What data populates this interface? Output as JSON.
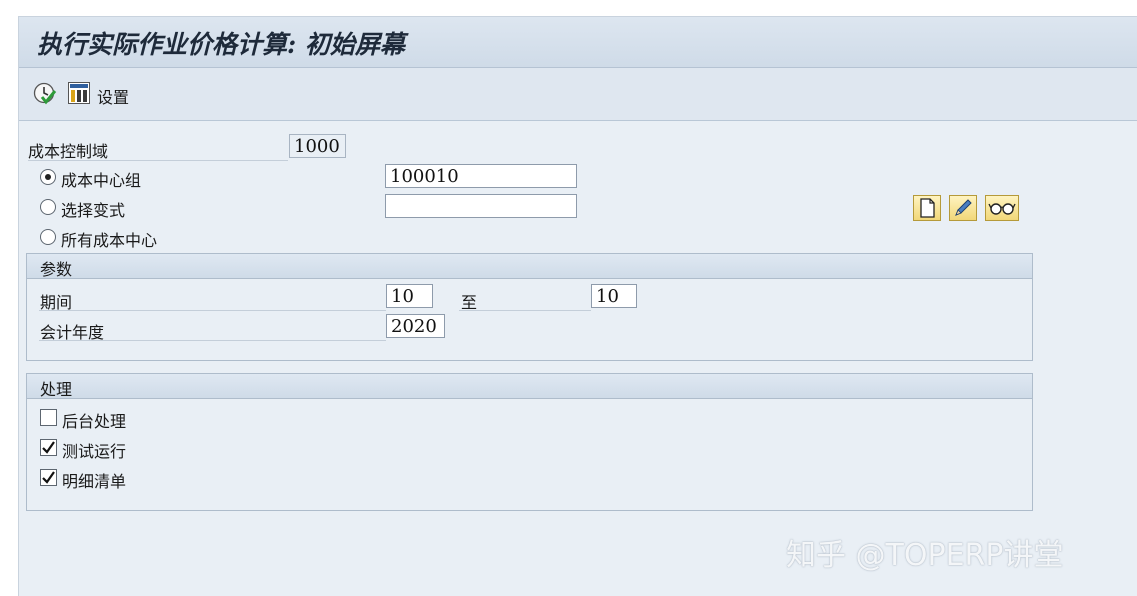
{
  "header": {
    "title": "执行实际作业价格计算: 初始屏幕"
  },
  "toolbar": {
    "settings_label": "设置"
  },
  "form": {
    "controlling_area": {
      "label": "成本控制域",
      "value": "1000"
    },
    "selection": {
      "options": [
        "成本中心组",
        "选择变式",
        "所有成本中心"
      ],
      "selected_index": 0,
      "group_value": "100010",
      "variant_value": ""
    }
  },
  "params": {
    "title": "参数",
    "period_label": "期间",
    "period_from": "10",
    "to_label": "至",
    "period_to": "10",
    "year_label": "会计年度",
    "year_value": "2020"
  },
  "processing": {
    "title": "处理",
    "options": [
      {
        "label": "后台处理",
        "checked": false
      },
      {
        "label": "测试运行",
        "checked": true
      },
      {
        "label": "明细清单",
        "checked": true
      }
    ]
  },
  "watermark": "知乎 @TOPERP讲堂"
}
